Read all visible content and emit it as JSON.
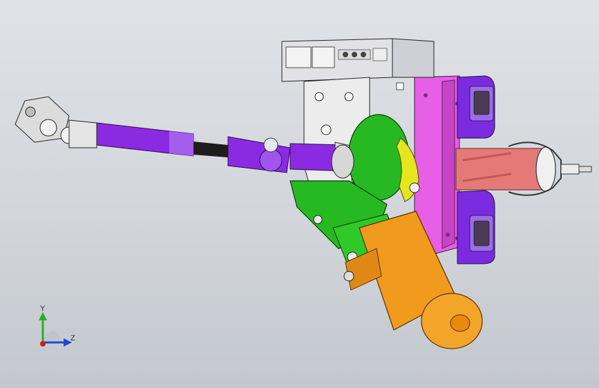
{
  "viewport": {
    "background_top": "#dfe2e6",
    "background_bottom": "#c3c8ce"
  },
  "model": {
    "parts": [
      {
        "name": "control-unit",
        "color": "#e2e2e6"
      },
      {
        "name": "mounting-bracket",
        "color": "#ececec"
      },
      {
        "name": "mounting-plate",
        "color": "#e75ee7"
      },
      {
        "name": "column-clamps",
        "color": "#7a2be0"
      },
      {
        "name": "intermediate-shaft",
        "color": "#8a2be2"
      },
      {
        "name": "universal-joint-left",
        "color": "#dcdcdc"
      },
      {
        "name": "gear-housing",
        "color": "#27b922"
      },
      {
        "name": "gear-cover",
        "color": "#e6e61e"
      },
      {
        "name": "electric-motor",
        "color": "#f09a1e"
      },
      {
        "name": "steering-tube",
        "color": "#e47a78"
      }
    ]
  },
  "triad": {
    "y_label": "Y",
    "z_label": "Z",
    "y_color": "#25b025",
    "z_color": "#2346d8",
    "x_color": "#d01c1c"
  }
}
